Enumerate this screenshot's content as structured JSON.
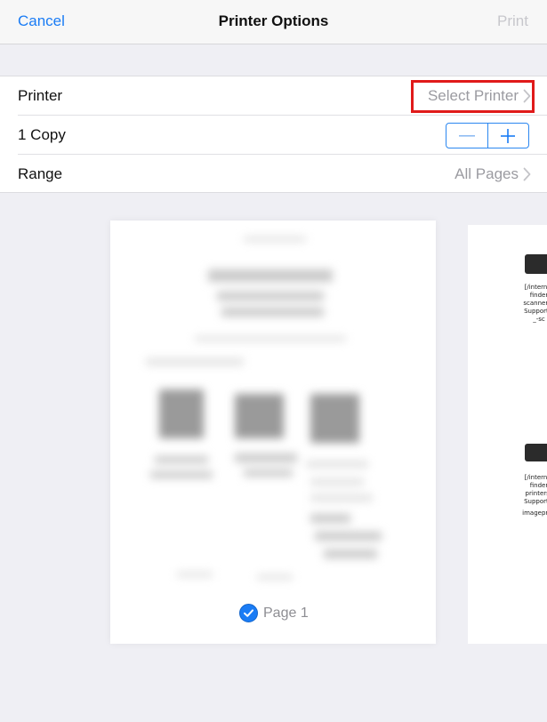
{
  "nav": {
    "cancel_label": "Cancel",
    "title": "Printer Options",
    "print_label": "Print"
  },
  "options": {
    "printer": {
      "label": "Printer",
      "value": "Select Printer"
    },
    "copies": {
      "label": "1 Copy",
      "minus": "−",
      "plus": "+"
    },
    "range": {
      "label": "Range",
      "value": "All Pages"
    }
  },
  "preview": {
    "page_label": "Page 1",
    "selected": true,
    "side_page": {
      "block1": [
        "[/internet",
        "finder",
        "scanners?",
        "SupportPl",
        "_-sc"
      ],
      "block2": [
        "[/internet",
        "finder",
        "printers?",
        "SupportPl"
      ],
      "block3": [
        "imageprog"
      ]
    }
  },
  "colors": {
    "accent": "#1a7cf5",
    "highlight": "#e01a1a",
    "disabled": "#c7c7cc",
    "background": "#efeff4"
  }
}
